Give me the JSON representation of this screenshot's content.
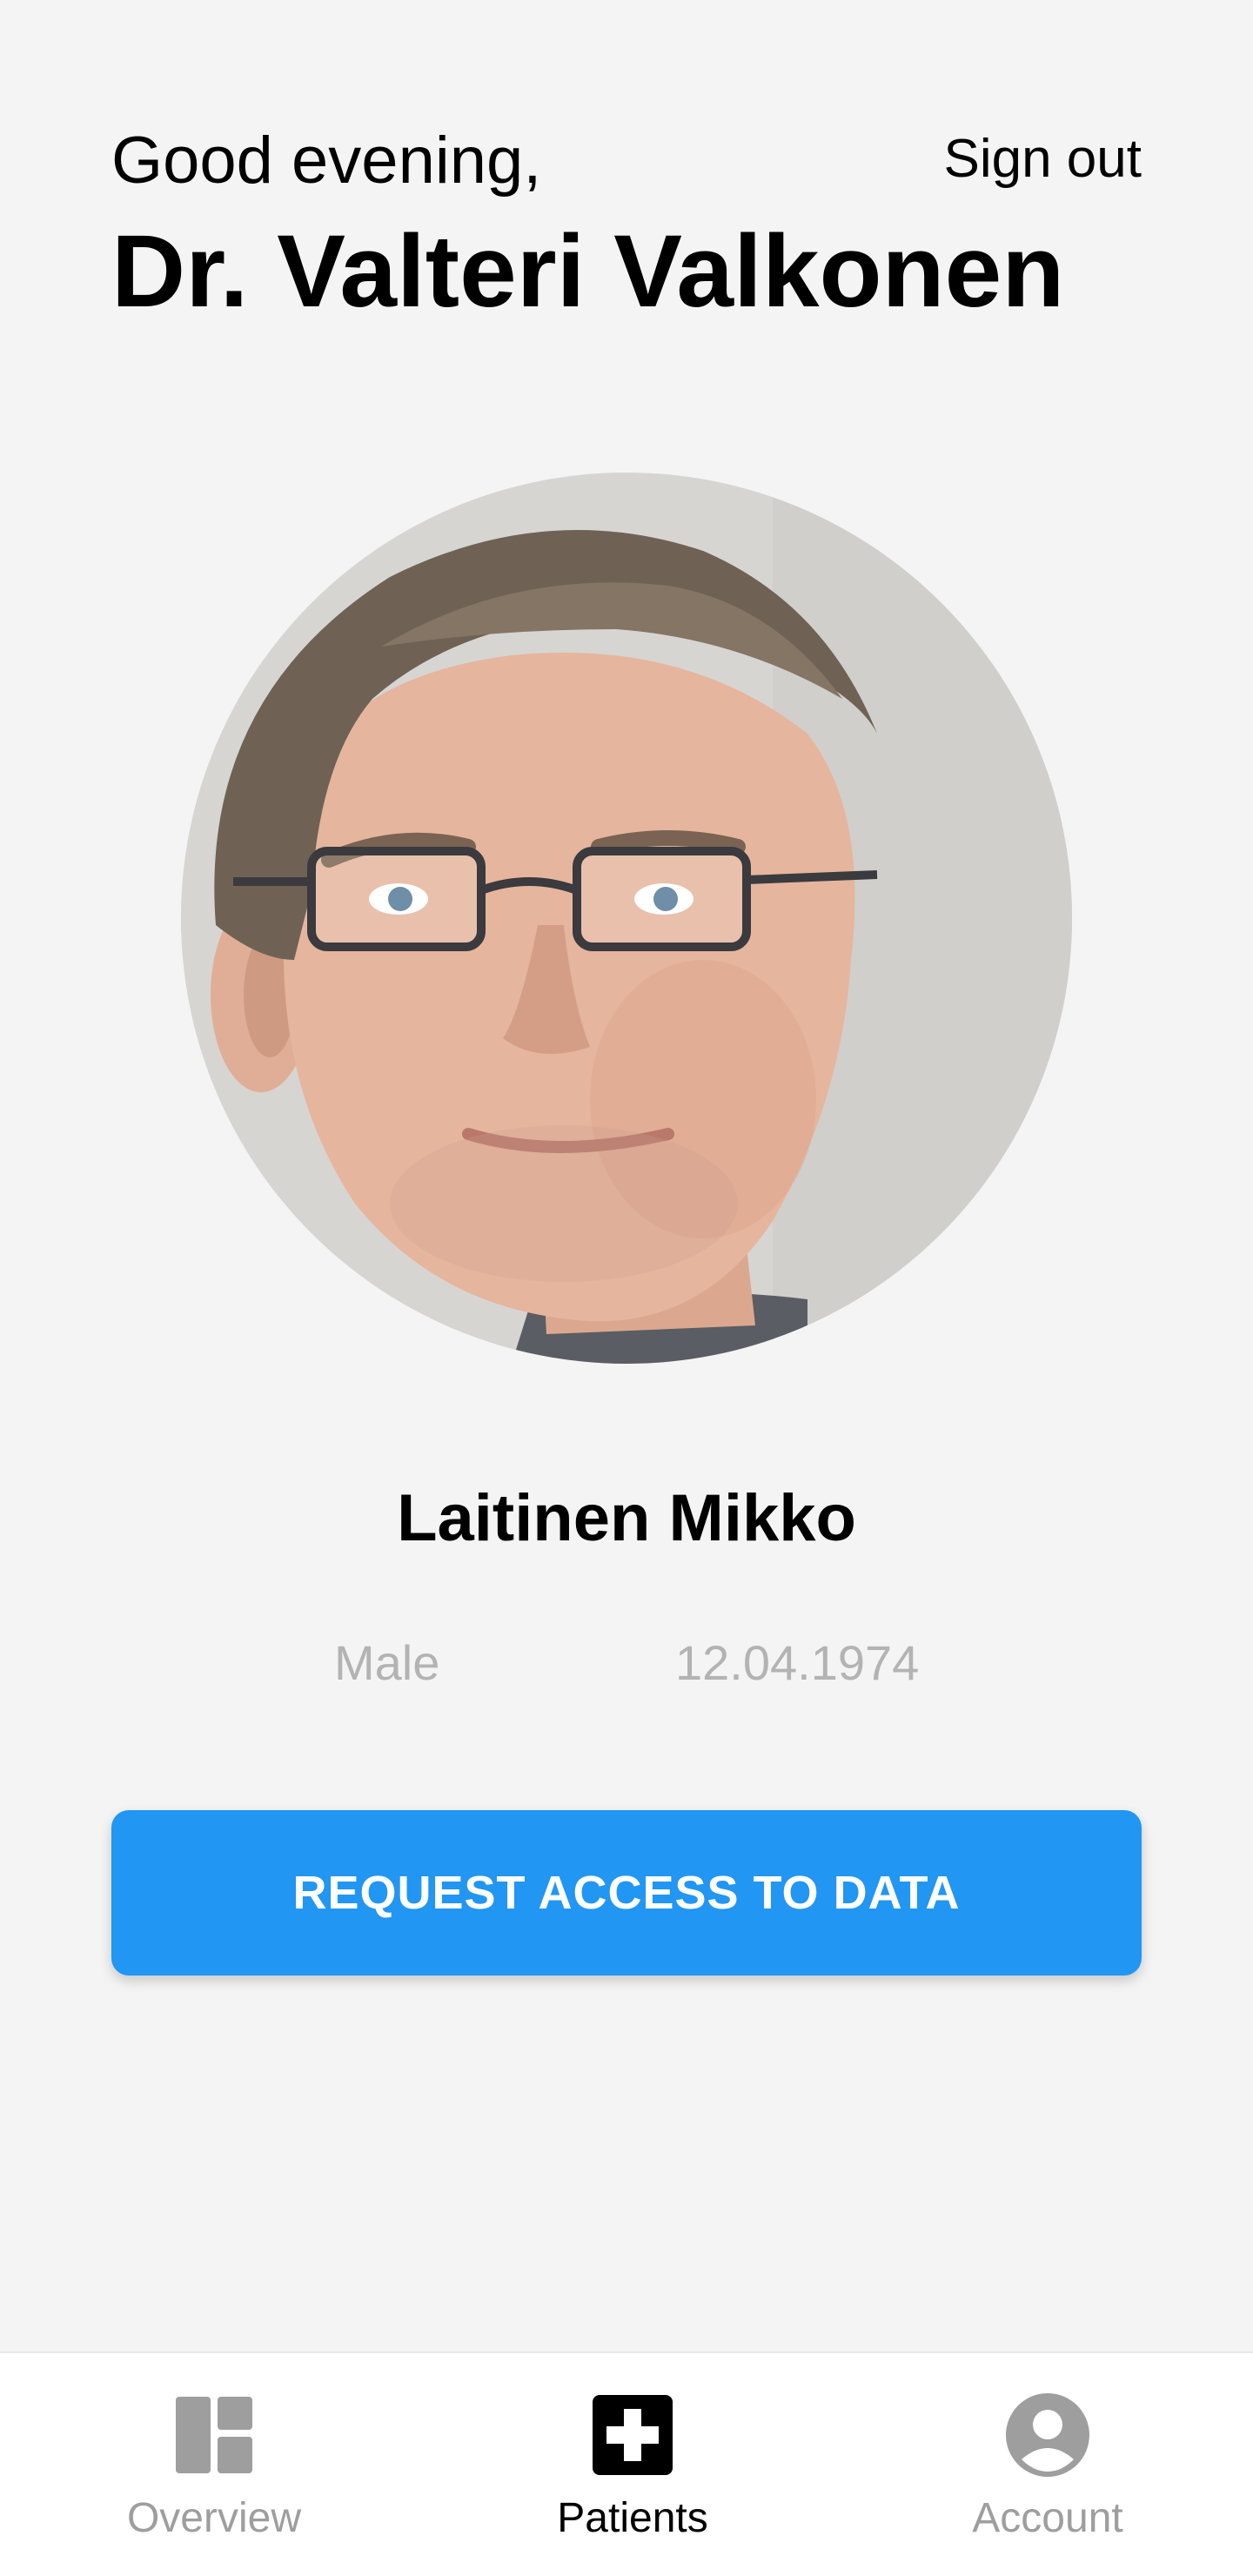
{
  "header": {
    "greeting": "Good evening,",
    "doctor_name": "Dr. Valteri Valkonen",
    "sign_out_label": "Sign out"
  },
  "patient": {
    "photo_icon": "patient-photo",
    "name": "Laitinen Mikko",
    "gender": "Male",
    "birth_date": "12.04.1974"
  },
  "action": {
    "request_access_label": "REQUEST ACCESS TO DATA"
  },
  "bottom_nav": {
    "items": [
      {
        "label": "Overview",
        "icon": "dashboard-icon",
        "active": false
      },
      {
        "label": "Patients",
        "icon": "medical-cross-icon",
        "active": true
      },
      {
        "label": "Account",
        "icon": "account-circle-icon",
        "active": false
      }
    ]
  },
  "colors": {
    "background": "#f4f4f4",
    "accent": "#2196f3",
    "inactive_nav": "#9e9e9e",
    "active_nav": "#000000",
    "muted_text": "#b3b3b3"
  }
}
